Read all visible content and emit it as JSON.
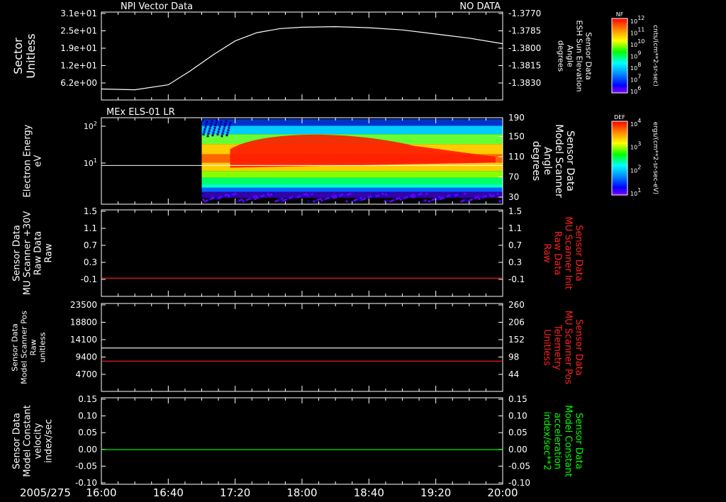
{
  "title_left": "NPI Vector Data",
  "title_right": "NO DATA",
  "date_label": "2005/275",
  "x_ticks": [
    "16:00",
    "16:40",
    "17:20",
    "18:00",
    "18:40",
    "19:20",
    "20:00"
  ],
  "colors": {
    "white": "#ffffff",
    "red": "#ff2020",
    "green": "#00ff00"
  },
  "chart_data": [
    {
      "type": "line",
      "panel": "sector",
      "ylabel": [
        "Sector",
        "Unitless"
      ],
      "ylabel_right": [
        "Sensor Data",
        "ESH Sun Elevation",
        "Angle",
        "degrees"
      ],
      "yticks": [
        "3.1e+01",
        "2.5e+01",
        "1.9e+01",
        "1.2e+01",
        "6.2e+00"
      ],
      "yticks_right": [
        "-1.3770",
        "-1.3785",
        "-1.3800",
        "-1.3815",
        "-1.3830"
      ],
      "ylim": [
        0,
        31
      ],
      "series": [
        {
          "x": [
            "16:00",
            "16:20",
            "16:40",
            "16:53",
            "17:07",
            "17:20",
            "17:33",
            "17:47",
            "18:00",
            "18:20",
            "18:40",
            "19:00",
            "19:20",
            "19:40",
            "20:00"
          ],
          "values": [
            3.5,
            3.2,
            5.0,
            10.0,
            16.0,
            21.0,
            24.0,
            25.5,
            26.0,
            26.2,
            25.8,
            25.0,
            23.5,
            22.0,
            20.0
          ]
        }
      ],
      "colorbar": {
        "title": "NF",
        "unit": "cnts/(cm**2-sr-sec)",
        "ticks": [
          "10^12",
          "10^11",
          "10^10",
          "10^9",
          "10^8",
          "10^7",
          "10^6"
        ]
      }
    },
    {
      "type": "heatmap",
      "panel": "els",
      "title": "MEx ELS-01 LR",
      "ylabel": [
        "Electron Energy",
        "eV"
      ],
      "ylabel_right": [
        "Sensor Data",
        "Model Scanner",
        "Angle",
        "degrees"
      ],
      "yticks": [
        "10^2",
        "10^1"
      ],
      "yticks_right": [
        "190",
        "150",
        "110",
        "70",
        "30"
      ],
      "overlay_line": {
        "label": "Model Scanner Angle",
        "y_right": 85
      },
      "data_start": "17:00",
      "colorbar": {
        "title": "DEF",
        "unit": "ergs/(cm**2-sr-sec-eV)",
        "ticks": [
          "10^4",
          "10^3",
          "10^2",
          "10^1"
        ]
      }
    },
    {
      "type": "line",
      "panel": "mu-raw",
      "ylabel": [
        "Sensor Data",
        "MU Scanner +30V",
        "Raw Data",
        "Raw"
      ],
      "ylabel_right": [
        "Sensor Data",
        "MU Scanner Init",
        "Raw Data",
        "Raw"
      ],
      "yticks": [
        "1.5",
        "1.1",
        "0.7",
        "0.3",
        "-0.1"
      ],
      "yticks_right": [
        "1.5",
        "1.1",
        "0.7",
        "0.3",
        "-0.1"
      ],
      "ylim": [
        -0.4,
        1.5
      ],
      "series": [
        {
          "axis": "right",
          "color": "red",
          "x": [
            "16:00",
            "20:00"
          ],
          "values": [
            0.0,
            0.0
          ]
        }
      ]
    },
    {
      "type": "line",
      "panel": "mu-pos",
      "ylabel": [
        "Sensor Data",
        "Model Scanner Pos",
        "Raw",
        "unitless"
      ],
      "ylabel_right": [
        "Sensor Data",
        "MU Scanner Pos",
        "Telemetry",
        "Unitless"
      ],
      "yticks": [
        "23500",
        "18800",
        "14100",
        "9400",
        "4700"
      ],
      "yticks_right": [
        "260",
        "206",
        "152",
        "98",
        "44"
      ],
      "ylim": [
        0,
        23500
      ],
      "series": [
        {
          "axis": "left",
          "color": "white",
          "x": [
            "16:00",
            "20:00"
          ],
          "values": [
            11600,
            11600
          ]
        },
        {
          "axis": "left",
          "color": "red",
          "x": [
            "16:00",
            "20:00"
          ],
          "values": [
            8100,
            8100
          ]
        }
      ]
    },
    {
      "type": "line",
      "panel": "model-constant",
      "ylabel": [
        "Sensor Data",
        "Model Constant",
        "velocity",
        "index/sec"
      ],
      "ylabel_right": [
        "Sensor Data",
        "Model Constant",
        "acceleration",
        "index/sec**2"
      ],
      "yticks": [
        "0.15",
        "0.10",
        "0.05",
        "0.00",
        "-0.05",
        "-0.10"
      ],
      "yticks_right": [
        "0.15",
        "0.10",
        "0.05",
        "0.00",
        "-0.05",
        "-0.10"
      ],
      "ylim": [
        -0.1,
        0.15
      ],
      "series": [
        {
          "axis": "right",
          "color": "green",
          "x": [
            "16:00",
            "20:00"
          ],
          "values": [
            0.0,
            0.0
          ]
        }
      ]
    }
  ]
}
